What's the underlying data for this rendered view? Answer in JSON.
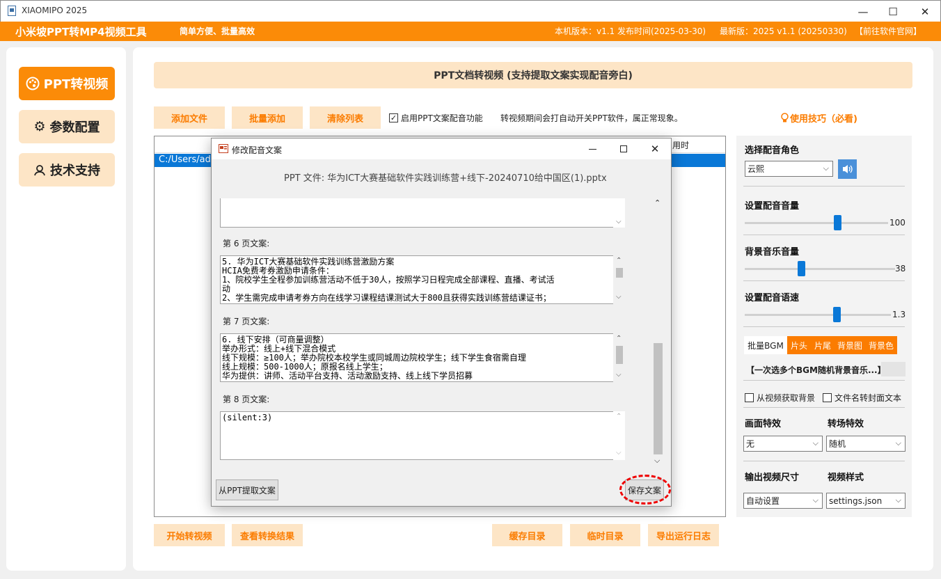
{
  "window": {
    "title": "XIAOMIPO 2025",
    "min": "—",
    "max": "☐",
    "close": "✕"
  },
  "header": {
    "app_name": "小米坡PPT转MP4视频工具",
    "slogan": "简单方便、批量高效",
    "version": "本机版本：v1.1  发布时间(2025-03-30)",
    "latest": "最新版：2025 v1.1 (20250330)",
    "site_link": "【前往软件官网】"
  },
  "nav": {
    "ppt_to_video": "PPT转视频",
    "settings": "参数配置",
    "support": "技术支持"
  },
  "main": {
    "banner": "PPT文档转视频 (支持提取文案实现配音旁白)",
    "toolbar": {
      "add_file": "添加文件",
      "batch_add": "批量添加",
      "clear_list": "清除列表",
      "enable_voice": "启用PPT文案配音功能",
      "notice": "转视频期间会打自动开关PPT软件，属正常现象。",
      "tips": "使用技巧（必看)"
    },
    "list": {
      "col_time": "用时",
      "row1_path": "C:/Users/adm"
    },
    "bottom": {
      "start": "开始转视频",
      "view_results": "查看转换结果",
      "cache_dir": "缓存目录",
      "temp_dir": "临时目录",
      "export_log": "导出运行日志"
    }
  },
  "right": {
    "voice_role_label": "选择配音角色",
    "voice_role": "云熙",
    "voice_volume_label": "设置配音音量",
    "voice_volume": 100,
    "bgm_volume_label": "背景音乐音量",
    "bgm_volume": 38,
    "speed_label": "设置配音语速",
    "speed": 1.3,
    "tabs": [
      "批量BGM",
      "片头",
      "片尾",
      "背景图",
      "背景色"
    ],
    "bgm_select": "【一次选多个BGM随机背景音乐...】",
    "bg_from_video": "从视频获取背景",
    "filename_cover": "文件名转封面文本",
    "effect_label": "画面特效",
    "effect": "无",
    "transition_label": "转场特效",
    "transition": "随机",
    "size_label": "输出视频尺寸",
    "size": "自动设置",
    "style_label": "视频样式",
    "style": "settings.json"
  },
  "dialog": {
    "title": "修改配音文案",
    "file": "PPT 文件: 华为ICT大赛基础软件实践训练营+线下-20240710给中国区(1).pptx",
    "p6_label": "第 6 页文案:",
    "p6_text": "5. 华为ICT大赛基础软件实践训练营激励方案\nHCIA免费考券激励申请条件：\n1、院校学生全程参加训练营活动不低于30人，按照学习日程完成全部课程、直播、考试活\n动\n2、学生需完成申请考券方向在线学习课程结课测试大于800且获得实践训练营结课证书；",
    "p7_label": "第 7 页文案:",
    "p7_text": "6. 线下安排（可商量调整）\n举办形式：线上+线下混合模式\n线下规模：≥100人；举办院校本校学生或同城周边院校学生；线下学生食宿需自理\n线上规模：500-1000人；原报名线上学生；\n华为提供：讲师、活动平台支持、活动激励支持、线上线下学员招募",
    "p8_label": "第 8 页文案:",
    "p8_text": "(silent:3)",
    "extract_button": "从PPT提取文案",
    "save_button": "保存文案"
  },
  "colors": {
    "accent": "#fb8b08",
    "accent_light": "#fde5c6",
    "selection": "#0a78d7"
  }
}
